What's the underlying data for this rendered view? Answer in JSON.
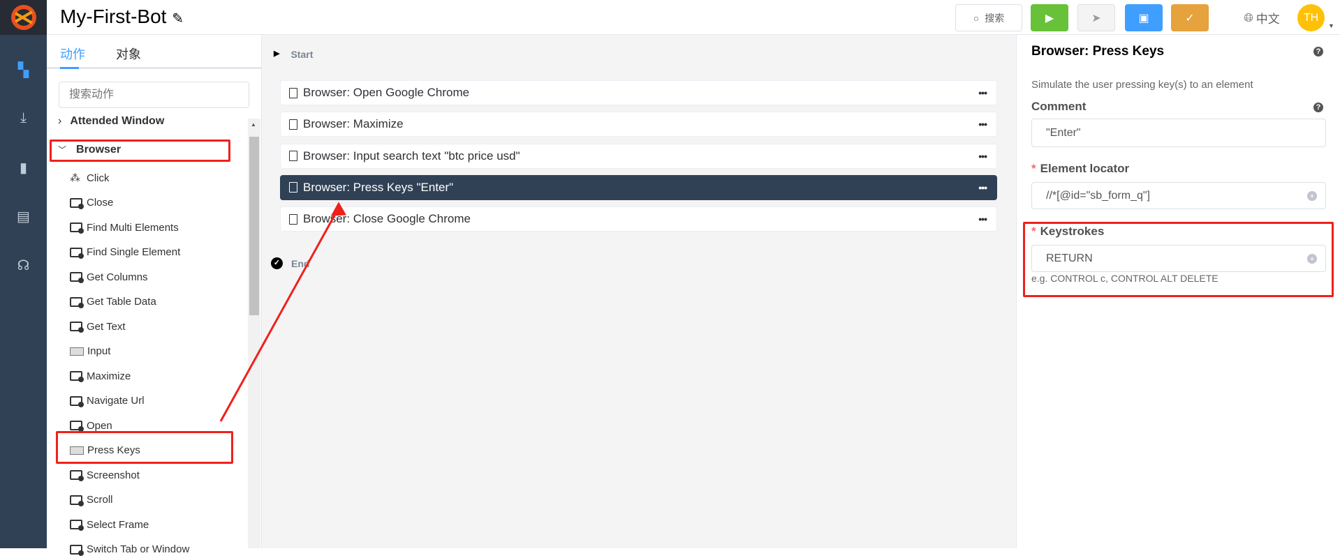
{
  "app": {
    "title": "My-First-Bot",
    "edit_icon": "pencil-icon"
  },
  "header": {
    "search_label": "搜索",
    "language": "中文",
    "avatar": "TH",
    "colors": {
      "run": "#67c23a",
      "save": "#409eff",
      "publish": "#e6a23c",
      "avatar": "#ffc107"
    }
  },
  "sidebar_nav": [
    "dashboard-icon",
    "download-icon",
    "chart-icon",
    "document-icon",
    "headset-icon"
  ],
  "left_panel": {
    "tabs": [
      {
        "label": "动作",
        "active": true
      },
      {
        "label": "对象",
        "active": false
      }
    ],
    "search_placeholder": "搜索动作",
    "groups": [
      {
        "label": "Attended Window",
        "expanded": false
      },
      {
        "label": "Browser",
        "expanded": true
      }
    ],
    "items": [
      {
        "label": "Click",
        "icon": "click-icon"
      },
      {
        "label": "Close",
        "icon": "browser-icon"
      },
      {
        "label": "Find Multi Elements",
        "icon": "browser-icon"
      },
      {
        "label": "Find Single Element",
        "icon": "browser-icon"
      },
      {
        "label": "Get Columns",
        "icon": "browser-icon"
      },
      {
        "label": "Get Table Data",
        "icon": "browser-icon"
      },
      {
        "label": "Get Text",
        "icon": "browser-icon"
      },
      {
        "label": "Input",
        "icon": "keyboard-icon"
      },
      {
        "label": "Maximize",
        "icon": "browser-icon"
      },
      {
        "label": "Navigate Url",
        "icon": "browser-icon"
      },
      {
        "label": "Open",
        "icon": "browser-icon"
      },
      {
        "label": "Press Keys",
        "icon": "keyboard-icon"
      },
      {
        "label": "Screenshot",
        "icon": "browser-icon"
      },
      {
        "label": "Scroll",
        "icon": "browser-icon"
      },
      {
        "label": "Select Frame",
        "icon": "browser-icon"
      },
      {
        "label": "Switch Tab or Window",
        "icon": "browser-icon"
      }
    ]
  },
  "flow": {
    "start": "Start",
    "end": "End",
    "steps": [
      {
        "label": "Browser: Open Google Chrome",
        "selected": false
      },
      {
        "label": "Browser: Maximize",
        "selected": false
      },
      {
        "label": "Browser: Input search text \"btc price usd\"",
        "selected": false
      },
      {
        "label": "Browser: Press Keys \"Enter\"",
        "selected": true
      },
      {
        "label": "Browser: Close Google Chrome",
        "selected": false
      }
    ]
  },
  "properties": {
    "title": "Browser: Press Keys",
    "description": "Simulate the user pressing key(s) to an element",
    "comment_label": "Comment",
    "comment_value": "\"Enter\"",
    "locator_label": "Element locator",
    "locator_value": "//*[@id=\"sb_form_q\"]",
    "keystrokes_label": "Keystrokes",
    "keystrokes_value": "RETURN",
    "keystrokes_hint": "e.g. CONTROL c, CONTROL ALT DELETE",
    "required_mark": "*"
  }
}
